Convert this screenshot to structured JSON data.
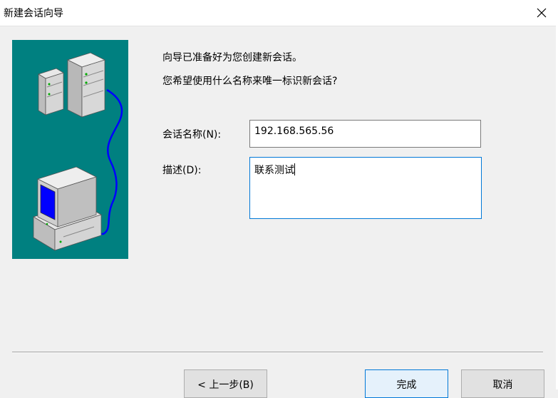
{
  "window": {
    "title": "新建会话向导",
    "close_icon": "close-icon"
  },
  "illustration": {
    "background": "#008080",
    "icons": [
      "server-tower-icon",
      "server-small-icon",
      "computer-monitor-icon",
      "network-cable-icon"
    ]
  },
  "intro": {
    "line1": "向导已准备好为您创建新会话。",
    "line2": "您希望使用什么名称来唯一标识新会话?"
  },
  "form": {
    "session_name_label": "会话名称(N):",
    "session_name_value": "192.168.565.56",
    "description_label": "描述(D):",
    "description_value": "联系测试"
  },
  "buttons": {
    "back": "< 上一步(B)",
    "finish": "完成",
    "cancel": "取消"
  },
  "colors": {
    "focus": "#0078d7",
    "teal": "#008080",
    "screen": "#0000ff"
  }
}
